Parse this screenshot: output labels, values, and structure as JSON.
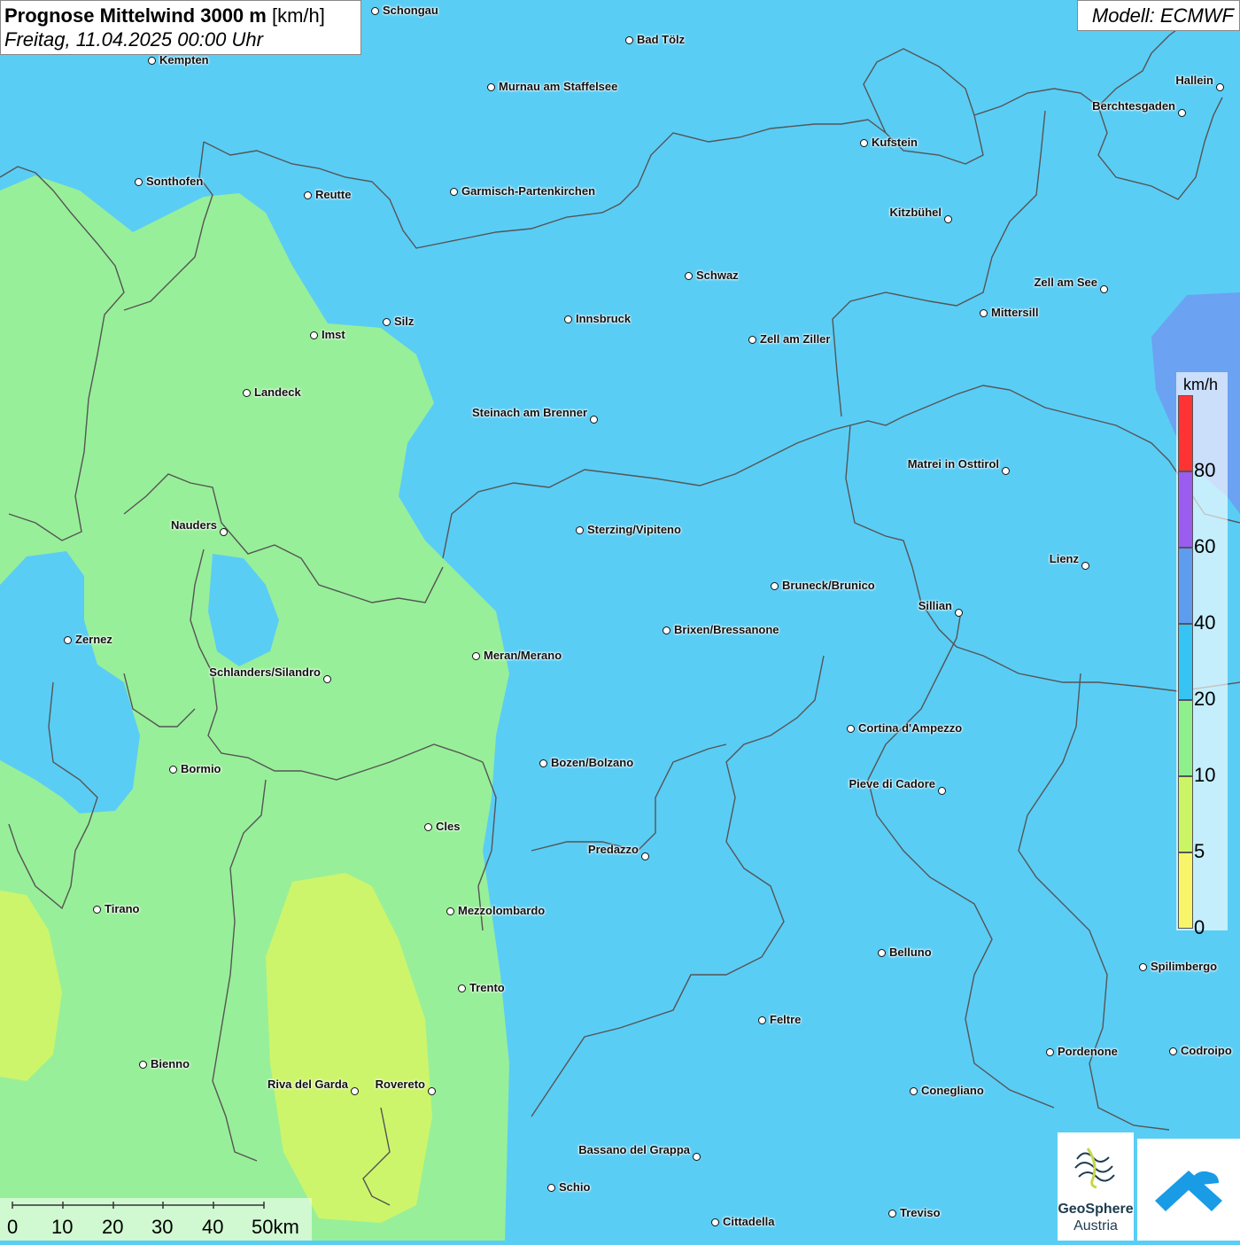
{
  "title": {
    "main": "Prognose Mittelwind 3000 m",
    "unit": "[km/h]",
    "date": "Freitag, 11.04.2025 00:00 Uhr"
  },
  "model_label": "Modell: ECMWF",
  "legend": {
    "unit": "km/h",
    "ticks": [
      "80",
      "60",
      "40",
      "20",
      "10",
      "5",
      "0"
    ],
    "colors": [
      "#ff3333",
      "#9b5cf0",
      "#5e9cf0",
      "#35c4f3",
      "#8ef08c",
      "#ccf566",
      "#f8f56a"
    ]
  },
  "scalebar": {
    "labels": [
      "0",
      "10",
      "20",
      "30",
      "40",
      "50km"
    ]
  },
  "logo": {
    "name_line1": "GeoSphere",
    "name_line2": "Austria"
  },
  "colors": {
    "wind_20_40": "#5acdf5",
    "wind_10_20": "#98ef99",
    "wind_5_10": "#cdf56b",
    "wind_40_60": "#6e9af0",
    "border": "#555555"
  },
  "cities": [
    {
      "name": "Schongau"
    },
    {
      "name": "Bad Tölz"
    },
    {
      "name": "Kempten"
    },
    {
      "name": "Murnau am Staffelsee"
    },
    {
      "name": "Hallein"
    },
    {
      "name": "Berchtesgaden"
    },
    {
      "name": "Kufstein"
    },
    {
      "name": "Sonthofen"
    },
    {
      "name": "Reutte"
    },
    {
      "name": "Garmisch-Partenkirchen"
    },
    {
      "name": "Kitzbühel"
    },
    {
      "name": "Schwaz"
    },
    {
      "name": "Zell am See"
    },
    {
      "name": "Mittersill"
    },
    {
      "name": "Innsbruck"
    },
    {
      "name": "Silz"
    },
    {
      "name": "Imst"
    },
    {
      "name": "Zell am Ziller"
    },
    {
      "name": "Landeck"
    },
    {
      "name": "Steinach am Brenner"
    },
    {
      "name": "Matrei in Osttirol"
    },
    {
      "name": "Nauders"
    },
    {
      "name": "Sterzing/Vipiteno"
    },
    {
      "name": "Lienz"
    },
    {
      "name": "Bruneck/Brunico"
    },
    {
      "name": "Sillian"
    },
    {
      "name": "Brixen/Bressanone"
    },
    {
      "name": "Zernez"
    },
    {
      "name": "Meran/Merano"
    },
    {
      "name": "Schlanders/Silandro"
    },
    {
      "name": "Cortina d'Ampezzo"
    },
    {
      "name": "Bozen/Bolzano"
    },
    {
      "name": "Bormio"
    },
    {
      "name": "Pieve di Cadore"
    },
    {
      "name": "Cles"
    },
    {
      "name": "Predazzo"
    },
    {
      "name": "Tirano"
    },
    {
      "name": "Mezzolombardo"
    },
    {
      "name": "Belluno"
    },
    {
      "name": "Spilimbergo"
    },
    {
      "name": "Trento"
    },
    {
      "name": "Feltre"
    },
    {
      "name": "Pordenone"
    },
    {
      "name": "Codroipo"
    },
    {
      "name": "Bienno"
    },
    {
      "name": "Riva del Garda"
    },
    {
      "name": "Rovereto"
    },
    {
      "name": "Conegliano"
    },
    {
      "name": "Bassano del Grappa"
    },
    {
      "name": "Schio"
    },
    {
      "name": "Treviso"
    },
    {
      "name": "Cittadella"
    }
  ]
}
